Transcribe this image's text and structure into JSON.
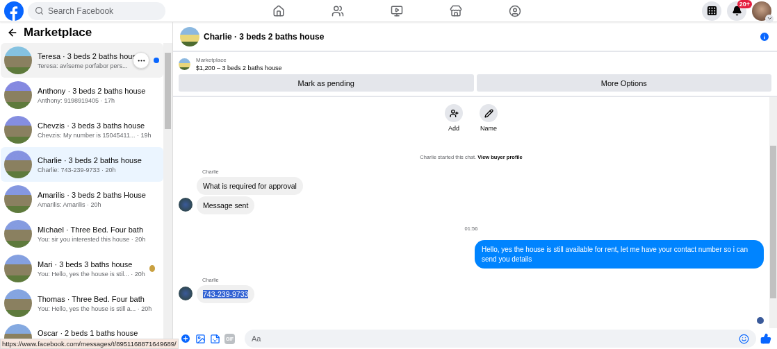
{
  "topbar": {
    "search": {
      "placeholder": "Search Facebook"
    },
    "nav": [
      {
        "kind": "home"
      },
      {
        "kind": "friends"
      },
      {
        "kind": "watch"
      },
      {
        "kind": "marketplace"
      },
      {
        "kind": "groups"
      }
    ],
    "notifications_badge": "20+"
  },
  "sidebar": {
    "title": "Marketplace",
    "conversations": [
      {
        "title": "Teresa · 3 beds 2 baths hous",
        "preview": "Teresa: avíseme porfabor pers...",
        "selected": false,
        "hovered": true,
        "unread": true,
        "seen": false
      },
      {
        "title": "Anthony · 3 beds 2 baths house",
        "preview": "Anthony: 9198919405 · 17h",
        "selected": false,
        "hovered": false,
        "unread": false,
        "seen": false
      },
      {
        "title": "Chevzis · 3 beds 3 baths house",
        "preview": "Chevzis: My number is 15045411... · 19h",
        "selected": false,
        "hovered": false,
        "unread": false,
        "seen": false
      },
      {
        "title": "Charlie · 3 beds 2 baths house",
        "preview": "Charlie: 743-239-9733 · 20h",
        "selected": true,
        "hovered": false,
        "unread": false,
        "seen": false
      },
      {
        "title": "Amarilis · 3 beds 2 baths House",
        "preview": "Amarilis: Amarilis · 20h",
        "selected": false,
        "hovered": false,
        "unread": false,
        "seen": false
      },
      {
        "title": "Michael · Three Bed. Four bath",
        "preview": "You: sir you interested this house · 20h",
        "selected": false,
        "hovered": false,
        "unread": false,
        "seen": false
      },
      {
        "title": "Mari · 3 beds 3 baths house",
        "preview": "You: Hello, yes the house is stil... · 20h",
        "selected": false,
        "hovered": false,
        "unread": false,
        "seen": true
      },
      {
        "title": "Thomas · Three Bed. Four bath",
        "preview": "You: Hello, yes the house is still a... · 20h",
        "selected": false,
        "hovered": false,
        "unread": false,
        "seen": false
      },
      {
        "title": "Oscar · 2 beds 1 baths house",
        "selected": false,
        "hovered": false,
        "unread": false,
        "seen": false
      }
    ]
  },
  "chat": {
    "title": "Charlie · 3 beds 2 baths house",
    "listing": {
      "label": "Marketplace",
      "price_title": "$1,200 – 3 beds 2 baths house"
    },
    "buttons": [
      "Mark as pending",
      "More Options"
    ],
    "actions": [
      {
        "kind": "add",
        "label": "Add"
      },
      {
        "kind": "name",
        "label": "Name"
      }
    ],
    "intro": {
      "text": "Charlie started this chat.",
      "link": "View buyer profile"
    },
    "messages": [
      {
        "kind": "sender",
        "text": "Charlie"
      },
      {
        "kind": "incoming",
        "text": "What is required for approval",
        "avatar": false,
        "highlighted": false
      },
      {
        "kind": "incoming",
        "text": "Message sent",
        "avatar": true,
        "highlighted": false
      },
      {
        "kind": "timestamp",
        "text": "01:56"
      },
      {
        "kind": "outgoing",
        "text": "Hello, yes the house is still available for rent, let me have your contact number so i can send you details"
      },
      {
        "kind": "sender",
        "text": "Charlie"
      },
      {
        "kind": "incoming",
        "text": "743-239-9733",
        "avatar": true,
        "highlighted": true
      }
    ],
    "composer": {
      "gif": "GIF",
      "placeholder": "Aa"
    }
  },
  "status_url": "https://www.facebook.com/messages/t/8951168871649689/"
}
